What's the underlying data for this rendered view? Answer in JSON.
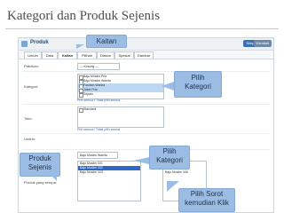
{
  "slide_title": "Kategori dan Produk Sejenis",
  "app": {
    "title": "Produk",
    "save_label": "Simpan",
    "back_label": "Kembali"
  },
  "tabs": [
    "Umum",
    "Data",
    "Kaitan",
    "Pilihan",
    "Diskon",
    "Spesial",
    "Gambar"
  ],
  "active_tab": "Kaitan",
  "fields": {
    "pabrikan_label": "Pabrikan:",
    "pabrikan_value": "--- Kosong ---",
    "kategori_label": "Kategori:",
    "kategori_items": [
      "Baju Muslim Pria",
      "Baju Muslim Wanita",
      "Fashion Wanita",
      "Jaket Pria",
      "Sepatu"
    ],
    "select_all": "Pilih semua",
    "unselect_all": "Tidak pilih semua",
    "toko_label": "Toko:",
    "toko_items": [
      "Standard"
    ],
    "unduh_label": "Unduh:",
    "produk_sejenis_label": "Produk yang serupa:",
    "filter_select_value": "Baju Muslim Wanita",
    "left_list": [
      "Baju Muslim 001",
      "Baju Muslim 002",
      "Baju Muslim 003"
    ],
    "right_list": [
      "Baju Muslim 004",
      "Baju Muslim 005",
      "Baju Muslim 006"
    ]
  },
  "callouts": {
    "kaitan": "Kaitan",
    "pilih_kategori": [
      "Pilih",
      "Kategori"
    ],
    "produk_sejenis": [
      "Produk",
      "Sejenis"
    ],
    "pilih_kategori_2": [
      "Pilih",
      "Kategori"
    ],
    "pilih_sorot": [
      "Pilih Sorot",
      "kemudian Klik"
    ]
  }
}
